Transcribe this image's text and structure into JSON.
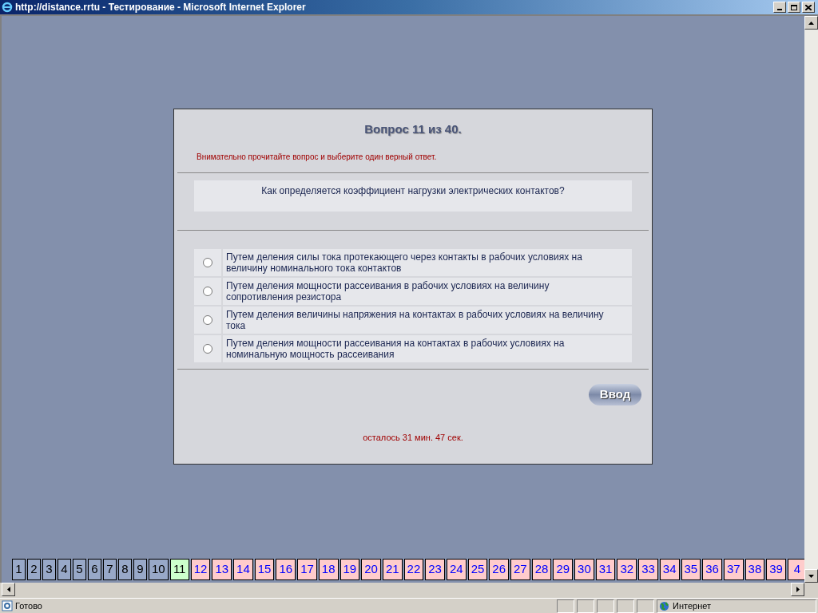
{
  "window": {
    "title": "http://distance.rrtu - Тестирование - Microsoft Internet Explorer"
  },
  "test": {
    "heading": "Вопрос 11 из 40.",
    "instruction": "Внимательно прочитайте вопрос и выберите один верный ответ.",
    "question": "Как определяется коэффициент нагрузки электрических контактов?",
    "answers": [
      {
        "text": "Путем деления силы тока протекающего через контакты в рабочих условиях на величину номинального тока контактов",
        "selected": false
      },
      {
        "text": "Путем деления мощности рассеивания в рабочих условиях на величину сопротивления резистора",
        "selected": false
      },
      {
        "text": "Путем деления величины напряжения на контактах в рабочих условиях на величину тока",
        "selected": false
      },
      {
        "text": "Путем деления мощности рассеивания на контактах в рабочих условиях на номинальную мощность рассеивания",
        "selected": false
      }
    ],
    "submit": "Ввод",
    "timer": "осталось 31 мин. 47 сек."
  },
  "question_nav": [
    {
      "label": "1",
      "kind": "answered"
    },
    {
      "label": "2",
      "kind": "answered"
    },
    {
      "label": "3",
      "kind": "answered"
    },
    {
      "label": "4",
      "kind": "answered"
    },
    {
      "label": "5",
      "kind": "answered"
    },
    {
      "label": "6",
      "kind": "answered"
    },
    {
      "label": "7",
      "kind": "answered"
    },
    {
      "label": "8",
      "kind": "answered"
    },
    {
      "label": "9",
      "kind": "answered"
    },
    {
      "label": "10",
      "kind": "answered"
    },
    {
      "label": "11",
      "kind": "current"
    },
    {
      "label": "12",
      "kind": "open"
    },
    {
      "label": "13",
      "kind": "open"
    },
    {
      "label": "14",
      "kind": "open"
    },
    {
      "label": "15",
      "kind": "open"
    },
    {
      "label": "16",
      "kind": "open"
    },
    {
      "label": "17",
      "kind": "open"
    },
    {
      "label": "18",
      "kind": "open"
    },
    {
      "label": "19",
      "kind": "open"
    },
    {
      "label": "20",
      "kind": "open"
    },
    {
      "label": "21",
      "kind": "open"
    },
    {
      "label": "22",
      "kind": "open"
    },
    {
      "label": "23",
      "kind": "open"
    },
    {
      "label": "24",
      "kind": "open"
    },
    {
      "label": "25",
      "kind": "open"
    },
    {
      "label": "26",
      "kind": "open"
    },
    {
      "label": "27",
      "kind": "open"
    },
    {
      "label": "28",
      "kind": "open"
    },
    {
      "label": "29",
      "kind": "open"
    },
    {
      "label": "30",
      "kind": "open"
    },
    {
      "label": "31",
      "kind": "open"
    },
    {
      "label": "32",
      "kind": "open"
    },
    {
      "label": "33",
      "kind": "open"
    },
    {
      "label": "34",
      "kind": "open"
    },
    {
      "label": "35",
      "kind": "open"
    },
    {
      "label": "36",
      "kind": "open"
    },
    {
      "label": "37",
      "kind": "open"
    },
    {
      "label": "38",
      "kind": "open"
    },
    {
      "label": "39",
      "kind": "open"
    },
    {
      "label": "4",
      "kind": "open"
    }
  ],
  "status_bar": {
    "text": "Готово",
    "zone": "Интернет"
  }
}
